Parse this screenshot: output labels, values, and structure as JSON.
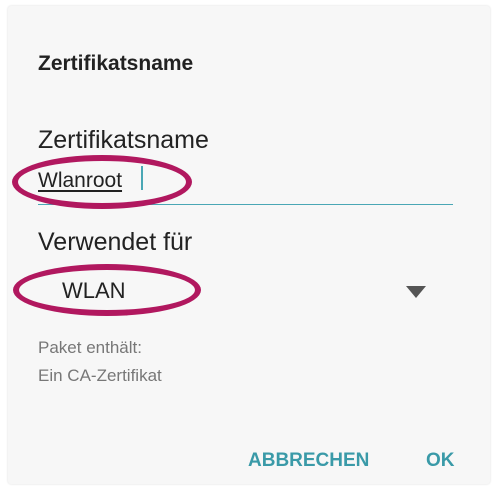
{
  "dialog": {
    "title": "Zertifikatsname",
    "name_field": {
      "label": "Zertifikatsname",
      "value": "Wlanroot"
    },
    "used_for": {
      "label": "Verwendet für",
      "selected": "WLAN",
      "caret_icon": "dropdown-triangle-icon"
    },
    "info": {
      "line1": "Paket enthält:",
      "line2": "Ein CA-Zertifikat"
    },
    "buttons": {
      "cancel": "ABBRECHEN",
      "ok": "OK"
    }
  },
  "colors": {
    "accent": "#3a9aa8",
    "highlight": "#b1185f",
    "background": "#f7f7f7"
  }
}
